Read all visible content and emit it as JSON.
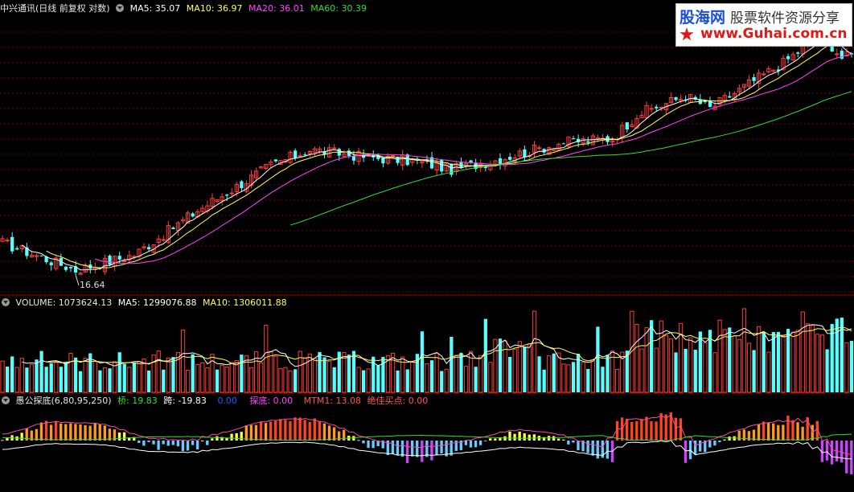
{
  "price_legend": {
    "title": "中兴通讯(日线 前复权 对数)",
    "ma5": "MA5: 35.07",
    "ma10": "MA10: 36.97",
    "ma20": "MA20: 36.01",
    "ma60": "MA60: 30.39",
    "low_label": "16.64"
  },
  "volume_legend": {
    "volume": "VOLUME: 1073624.13",
    "ma5": "MA5: 1299076.88",
    "ma10": "MA10: 1306011.88"
  },
  "indicator_legend": {
    "name": "愚公探底(6,80,95,250)",
    "qiao": "桥: 19.83",
    "kua": "跨: -19.83",
    "blank": "0.00",
    "tandi": "探底: 0.00",
    "mtm1": "MTM1: 13.08",
    "best_buy": "绝佳买点: 0.00"
  },
  "watermark": {
    "name": "股海网",
    "slogan": "股票软件资源分享",
    "url": "www.Guhai.com.cn"
  },
  "colors": {
    "up": "#ff3b3b",
    "down": "#54ffff",
    "ma5": "#ffffff",
    "ma10": "#ffff55",
    "ma20": "#ff44ff",
    "ma60": "#33dd33",
    "grid": "#7a0000",
    "separator": "#aa0000"
  },
  "chart_data": [
    {
      "type": "candlestick",
      "title": "中兴通讯(日线 前复权 对数)",
      "scale": "log",
      "grid": true,
      "annotations": [
        {
          "label": "16.64",
          "kind": "low_point"
        }
      ],
      "key_closes": [
        {
          "x": 0,
          "close": 19.0
        },
        {
          "x": 15,
          "close": 16.8
        },
        {
          "x": 27,
          "close": 18.0
        },
        {
          "x": 40,
          "close": 22.0
        },
        {
          "x": 55,
          "close": 27.0
        },
        {
          "x": 63,
          "close": 29.0
        },
        {
          "x": 75,
          "close": 28.0
        },
        {
          "x": 85,
          "close": 27.5
        },
        {
          "x": 92,
          "close": 26.5
        },
        {
          "x": 100,
          "close": 27.5
        },
        {
          "x": 115,
          "close": 30.0
        },
        {
          "x": 125,
          "close": 30.5
        },
        {
          "x": 130,
          "close": 34.0
        },
        {
          "x": 140,
          "close": 37.0
        },
        {
          "x": 145,
          "close": 35.0
        },
        {
          "x": 150,
          "close": 37.5
        },
        {
          "x": 160,
          "close": 43.0
        },
        {
          "x": 168,
          "close": 49.0
        },
        {
          "x": 172,
          "close": 44.0
        }
      ],
      "series": [
        {
          "name": "MA5",
          "value": 35.07
        },
        {
          "name": "MA10",
          "value": 36.97
        },
        {
          "name": "MA20",
          "value": 36.01
        },
        {
          "name": "MA60",
          "value": 30.39
        }
      ]
    },
    {
      "type": "bar",
      "series": [
        {
          "name": "VOLUME",
          "value": 1073624.13
        },
        {
          "name": "MA5",
          "value": 1299076.88
        },
        {
          "name": "MA10",
          "value": 1306011.88
        }
      ]
    },
    {
      "type": "bar",
      "title": "愚公探底(6,80,95,250)",
      "series": [
        {
          "name": "桥",
          "value": 19.83
        },
        {
          "name": "跨",
          "value": -19.83
        },
        {
          "name": "探底",
          "value": 0.0
        },
        {
          "name": "MTM1",
          "value": 13.08
        },
        {
          "name": "绝佳买点",
          "value": 0.0
        }
      ]
    }
  ]
}
